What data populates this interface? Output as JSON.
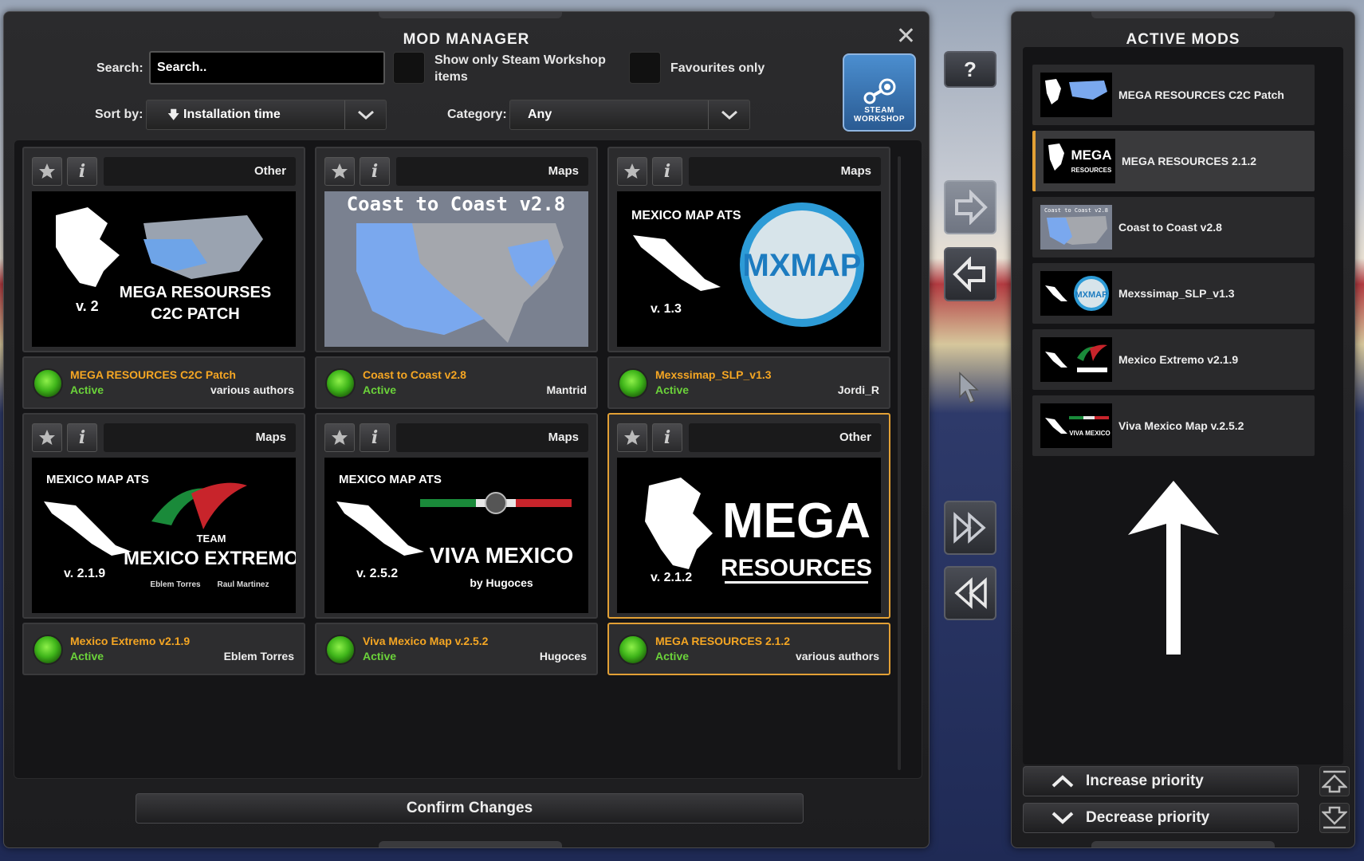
{
  "mod_manager": {
    "title": "MOD MANAGER",
    "search": {
      "label": "Search:",
      "value": "Search.."
    },
    "steam_only_label": "Show only Steam Workshop items",
    "favourites_label": "Favourites only",
    "sort": {
      "label": "Sort by:",
      "value": "Installation time"
    },
    "category": {
      "label": "Category:",
      "value": "Any"
    },
    "workshop": {
      "line1": "STEAM",
      "line2": "WORKSHOP"
    },
    "confirm_label": "Confirm Changes"
  },
  "mods": [
    {
      "category": "Other",
      "name": "MEGA RESOURCES C2C Patch",
      "status": "Active",
      "author": "various authors",
      "thumb": {
        "line1": "MEGA RESOURSES",
        "line2": "C2C PATCH",
        "ver": "v. 2"
      }
    },
    {
      "category": "Maps",
      "name": "Coast to Coast v2.8",
      "status": "Active",
      "author": "Mantrid",
      "thumb": {
        "line1": "Coast to Coast v2.8"
      }
    },
    {
      "category": "Maps",
      "name": "Mexssimap_SLP_v1.3",
      "status": "Active",
      "author": "Jordi_R",
      "thumb": {
        "line1": "MEXICO MAP ATS",
        "line2": "MXMAP",
        "ver": "v. 1.3"
      }
    },
    {
      "category": "Maps",
      "name": "Mexico Extremo v2.1.9",
      "status": "Active",
      "author": "Eblem Torres",
      "thumb": {
        "line1": "MEXICO MAP ATS",
        "line2": "TEAM",
        "line3": "MEXICO EXTREMO",
        "line4": "Eblem Torres",
        "line5": "Raul Martinez",
        "ver": "v. 2.1.9"
      }
    },
    {
      "category": "Maps",
      "name": "Viva Mexico Map v.2.5.2",
      "status": "Active",
      "author": "Hugoces",
      "thumb": {
        "line1": "MEXICO MAP ATS",
        "line2": "VIVA MEXICO",
        "line3": "by Hugoces",
        "ver": "v. 2.5.2"
      }
    },
    {
      "category": "Other",
      "name": "MEGA RESOURCES 2.1.2",
      "status": "Active",
      "author": "various authors",
      "thumb": {
        "line1": "MEGA",
        "line2": "RESOURCES",
        "ver": "v. 2.1.2"
      }
    }
  ],
  "active_mods": {
    "title": "ACTIVE MODS",
    "items": [
      {
        "label": "MEGA RESOURCES C2C Patch"
      },
      {
        "label": "MEGA RESOURCES 2.1.2",
        "mini": "MEGA",
        "mini2": "RESOURCES"
      },
      {
        "label": "Coast to Coast v2.8",
        "mini": "Coast to Coast v2.8"
      },
      {
        "label": "Mexssimap_SLP_v1.3",
        "mini": "MXMAP"
      },
      {
        "label": "Mexico Extremo v2.1.9"
      },
      {
        "label": "Viva Mexico Map v.2.5.2",
        "mini": "VIVA MEXICO"
      }
    ],
    "increase_label": "Increase priority",
    "decrease_label": "Decrease priority"
  },
  "help_label": "?",
  "colors": {
    "accent": "#e2a035",
    "active_green": "#6bd23a",
    "mod_name": "#f5a623"
  }
}
